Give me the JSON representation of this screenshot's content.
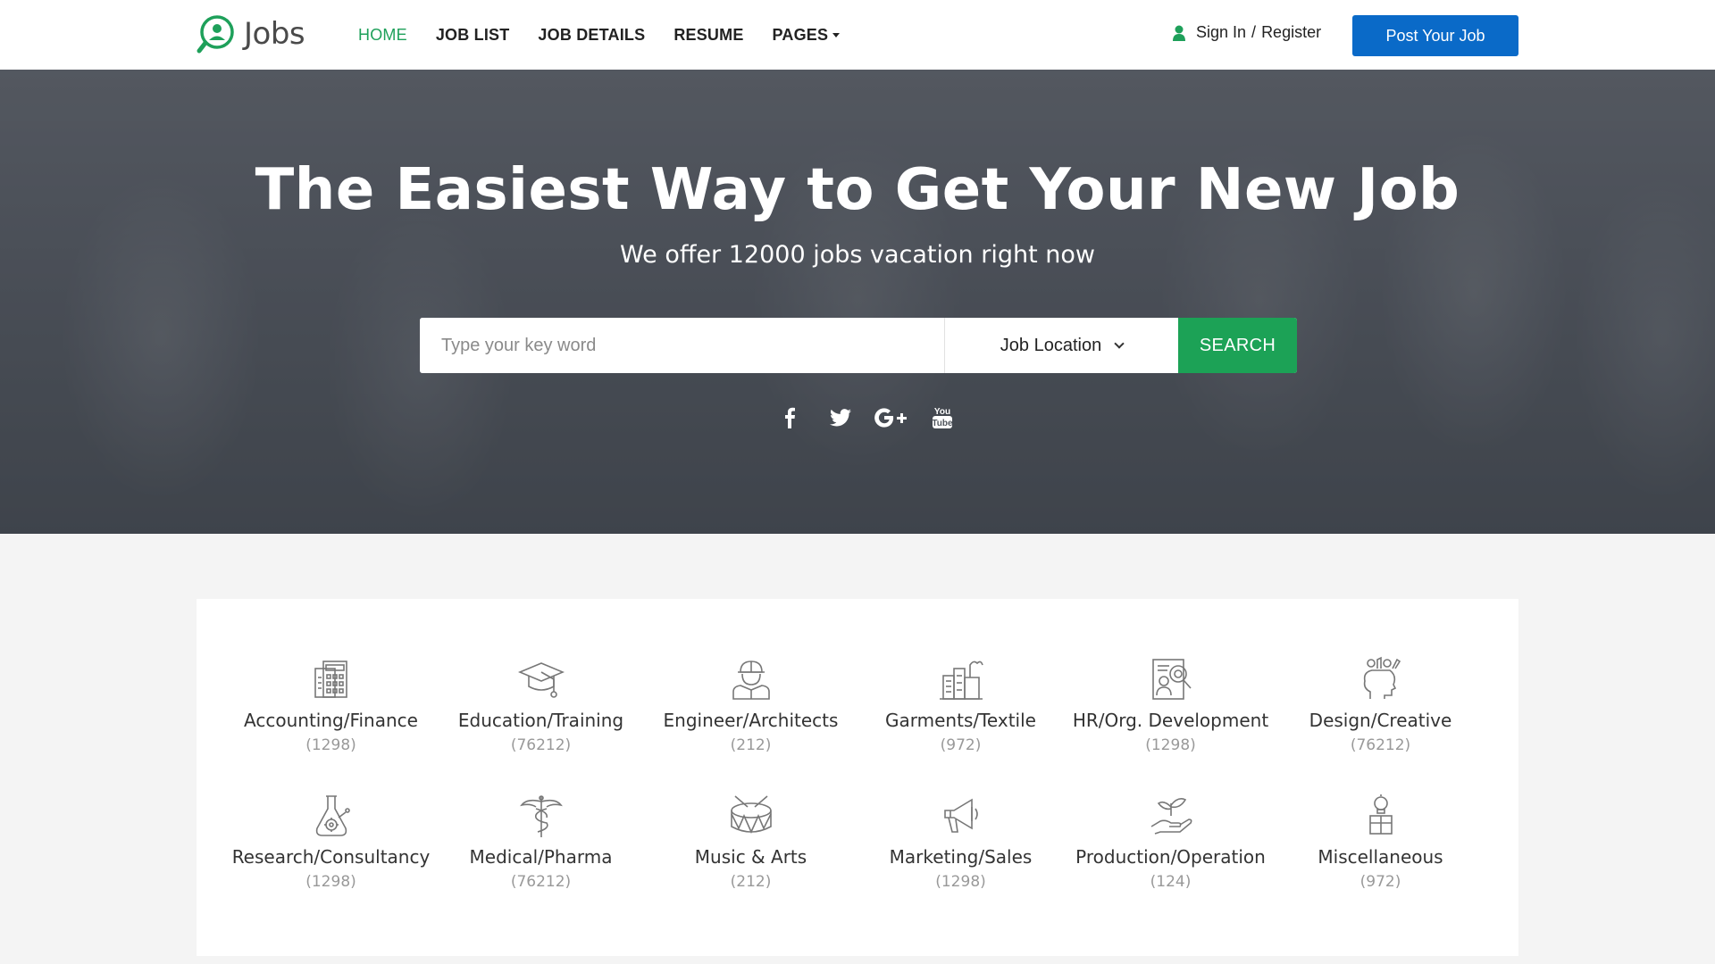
{
  "brand": {
    "name": "Jobs",
    "accent": "#1ea05a",
    "primary": "#0a6ac8"
  },
  "nav": {
    "items": [
      {
        "label": "HOME",
        "active": true
      },
      {
        "label": "JOB LIST"
      },
      {
        "label": "JOB DETAILS"
      },
      {
        "label": "RESUME"
      },
      {
        "label": "PAGES"
      }
    ]
  },
  "auth": {
    "sign_in": "Sign In",
    "separator": "/",
    "register": "Register",
    "icon": "user-icon"
  },
  "header": {
    "post_button": "Post Your Job"
  },
  "hero": {
    "title": "The Easiest Way to Get Your New Job",
    "subtitle": "We offer 12000 jobs vacation right now",
    "search": {
      "placeholder": "Type your key word",
      "location_label": "Job Location",
      "button": "SEARCH"
    },
    "social": [
      "facebook-icon",
      "twitter-icon",
      "google-plus-icon",
      "youtube-icon"
    ]
  },
  "categories": [
    {
      "name": "Accounting/Finance",
      "count": "(1298)",
      "icon": "calculator-icon"
    },
    {
      "name": "Education/Training",
      "count": "(76212)",
      "icon": "graduation-cap-icon"
    },
    {
      "name": "Engineer/Architects",
      "count": "(212)",
      "icon": "engineer-icon"
    },
    {
      "name": "Garments/Textile",
      "count": "(972)",
      "icon": "factory-icon"
    },
    {
      "name": "HR/Org. Development",
      "count": "(1298)",
      "icon": "hr-icon"
    },
    {
      "name": "Design/Creative",
      "count": "(76212)",
      "icon": "creative-head-icon"
    },
    {
      "name": "Research/Consultancy",
      "count": "(1298)",
      "icon": "research-flask-icon"
    },
    {
      "name": "Medical/Pharma",
      "count": "(76212)",
      "icon": "caduceus-icon"
    },
    {
      "name": "Music & Arts",
      "count": "(212)",
      "icon": "drum-icon"
    },
    {
      "name": "Marketing/Sales",
      "count": "(1298)",
      "icon": "megaphone-icon"
    },
    {
      "name": "Production/Operation",
      "count": "(124)",
      "icon": "plant-hand-icon"
    },
    {
      "name": "Miscellaneous",
      "count": "(972)",
      "icon": "bulb-icon"
    }
  ]
}
